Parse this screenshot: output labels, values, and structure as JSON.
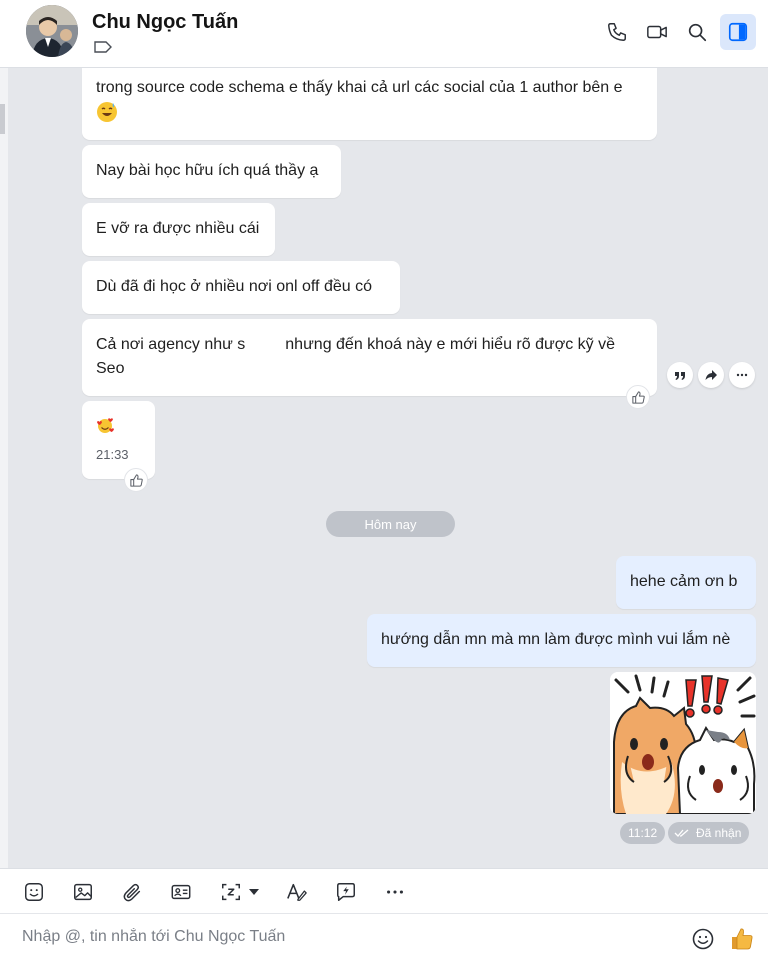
{
  "header": {
    "contact_name": "Chu Ngọc Tuấn",
    "icons": [
      "phone-icon",
      "video-icon",
      "search-icon",
      "sidebar-toggle-icon"
    ]
  },
  "messages": [
    {
      "text": "trong source code schema e thấy khai cả url các social của 1 author bên e",
      "emoji": "sweat-smile-emoji"
    },
    {
      "text": "Nay bài học hữu ích quá thầy ạ"
    },
    {
      "text": "E vỡ ra được nhiều cái"
    },
    {
      "text": "Dù đã đi học ở nhiều nơi onl off đều có"
    },
    {
      "text_part1": "Cả nơi agency như s",
      "text_part2": "nhưng đến khoá này e mới hiểu rõ được kỹ về Seo"
    },
    {
      "emoji": "smiling-hearts-emoji",
      "time": "21:33"
    }
  ],
  "date_divider": "Hôm nay",
  "outgoing": [
    {
      "text": "hehe cảm ơn b"
    },
    {
      "text": "hướng dẫn mn mà mn làm được mình vui lắm nè"
    }
  ],
  "sticker": {
    "name": "shocked-cats-sticker",
    "time": "11:12",
    "status": "Đã nhận"
  },
  "composer": {
    "placeholder": "Nhập @, tin nhắn tới Chu Ngọc Tuấn"
  },
  "colors": {
    "accent": "#0068ff",
    "outgoing_bubble": "#e5efff",
    "background": "#e5e7eb"
  }
}
